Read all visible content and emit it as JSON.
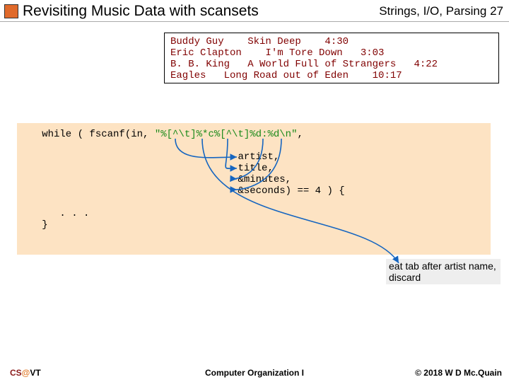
{
  "header": {
    "title": "Revisiting Music Data with scansets",
    "section": "Strings, I/O, Parsing",
    "page": "27"
  },
  "data_lines": [
    "Buddy Guy    Skin Deep    4:30",
    "Eric Clapton    I'm Tore Down   3:03",
    "B. B. King   A World Full of Strangers   4:22",
    "Eagles   Long Road out of Eden    10:17"
  ],
  "code": {
    "l1_head": "   while ( fscanf(in, ",
    "l1_fmt": "\"%[^\\t]%*c%[^\\t]%d:%d\\n\"",
    "l1_tail": ",",
    "l2": "",
    "l3": "                                    artist,",
    "l4": "                                    title,",
    "l5": "                                    &minutes,",
    "l6": "                                    &seconds) == 4 ) {",
    "l7": "",
    "l8": "      . . .",
    "l9": "   }"
  },
  "annotation": "eat tab after artist name, discard",
  "footer": {
    "left_cs": "CS",
    "left_at": "@",
    "left_vt": "VT",
    "center": "Computer Organization I",
    "right": "© 2018 W D Mc.Quain"
  }
}
